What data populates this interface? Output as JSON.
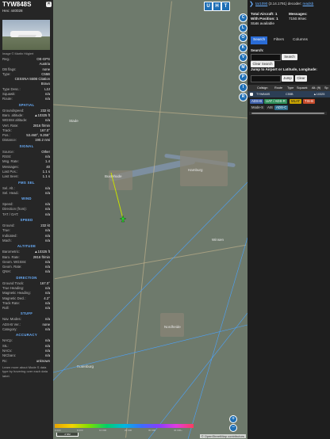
{
  "aircraft": {
    "callsign": "TYW848S",
    "hex_label": "Hex: ",
    "hex": "440028",
    "photo_credit": "Image © Martin Höglert"
  },
  "sidebar_rows_top": [
    {
      "k": "Reg.:",
      "v": "OE-GPS"
    },
    {
      "k": "",
      "v": "Austria"
    },
    {
      "k": "DB flags:",
      "v": "none"
    },
    {
      "k": "Type:",
      "v": "C55B"
    },
    {
      "k": "",
      "v": "CESSNA 550B Citation"
    },
    {
      "k": "",
      "v": "Bravo"
    },
    {
      "k": "Type Desc.:",
      "v": "L2J"
    },
    {
      "k": "Squawk:",
      "v": "n/a"
    },
    {
      "k": "Route:",
      "v": "n/a"
    }
  ],
  "sections": [
    {
      "title": "SPATIAL",
      "rows": [
        {
          "k": "Groundspeed:",
          "v": "232 kt"
        },
        {
          "k": "Baro. altitude:",
          "v": "▲10325 ft"
        },
        {
          "k": "WGS84 altitude:",
          "v": "n/a"
        },
        {
          "k": "Vert. Rate:",
          "v": "2816 ft/min"
        },
        {
          "k": "Track:",
          "v": "167.0°"
        },
        {
          "k": "Pos.:",
          "v": "53.460°, 9.255°"
        },
        {
          "k": "Distance:",
          "v": "190.2 nmi"
        }
      ]
    },
    {
      "title": "SIGNAL",
      "rows": [
        {
          "k": "Source:",
          "v": "Other"
        },
        {
          "k": "RSSI:",
          "v": "n/a"
        },
        {
          "k": "Msg. Rate:",
          "v": "1.4"
        },
        {
          "k": "Messages:",
          "v": "40"
        },
        {
          "k": "Last Pos.:",
          "v": "1.1 s"
        },
        {
          "k": "Last Seen:",
          "v": "1.1 s"
        }
      ]
    },
    {
      "title": "FMS SEL",
      "rows": [
        {
          "k": "Sel. Alt.:",
          "v": "n/a"
        },
        {
          "k": "Sel. Head.:",
          "v": "n/a"
        }
      ]
    },
    {
      "title": "WIND",
      "rows": [
        {
          "k": "Speed:",
          "v": "n/a"
        },
        {
          "k": "Direction (from):",
          "v": "n/a"
        },
        {
          "k": "TAT / OAT:",
          "v": "n/a"
        }
      ]
    },
    {
      "title": "SPEED",
      "rows": [
        {
          "k": "Ground:",
          "v": "232 kt"
        },
        {
          "k": "True:",
          "v": "n/a"
        },
        {
          "k": "Indicated:",
          "v": "n/a"
        },
        {
          "k": "Mach:",
          "v": "n/a"
        }
      ]
    },
    {
      "title": "ALTITUDE",
      "rows": [
        {
          "k": "Barometric:",
          "v": "▲10325 ft"
        },
        {
          "k": "Baro. Rate:",
          "v": "2816 ft/min"
        },
        {
          "k": "Geom. WGS84:",
          "v": "n/a"
        },
        {
          "k": "Geom. Rate:",
          "v": "n/a"
        },
        {
          "k": "QNH:",
          "v": "n/a"
        }
      ]
    },
    {
      "title": "DIRECTION",
      "rows": [
        {
          "k": "Ground Track:",
          "v": "167.0°"
        },
        {
          "k": "True Heading:",
          "v": "n/a"
        },
        {
          "k": "Magnetic Heading:",
          "v": "n/a"
        },
        {
          "k": "Magnetic Decl.:",
          "v": "4.2°"
        },
        {
          "k": "Track Rate:",
          "v": "n/a"
        },
        {
          "k": "Roll:",
          "v": "n/a"
        }
      ]
    },
    {
      "title": "STUFF",
      "rows": [
        {
          "k": "Nav. Modes:",
          "v": "n/a"
        },
        {
          "k": "ADS-B Ver.:",
          "v": "none"
        },
        {
          "k": "Category:",
          "v": "n/a"
        }
      ]
    },
    {
      "title": "ACCURACY",
      "rows": [
        {
          "k": "NACp:",
          "v": "n/a"
        },
        {
          "k": "SIL:",
          "v": "n/a"
        },
        {
          "k": "NACv:",
          "v": "n/a"
        },
        {
          "k": "NICbaro:",
          "v": "n/a"
        },
        {
          "k": "Rc:",
          "v": "unknown"
        }
      ]
    }
  ],
  "footer_text": "Learn more about Mode S data type by hovering over each data label.",
  "map": {
    "buttons": [
      "U",
      "H",
      "T"
    ],
    "labels": [
      "Buxtehude",
      "Hamburg",
      "Stade",
      "Winsen",
      "Nordheide",
      "Rotenburg"
    ],
    "altitude_ticks": [
      "6 000",
      "8 000",
      "10 000",
      "20 000",
      "30 000",
      "40 000+"
    ],
    "scale": "2 NM",
    "attribution": "© OpenStreetMap contributors",
    "zoom_in": "+",
    "zoom_out": "−"
  },
  "toolbar": [
    "C",
    "L",
    "O",
    "K",
    "V",
    "M",
    "P",
    "I",
    "R"
  ],
  "panel": {
    "arrow": "❯",
    "version_prefix": "tar1090",
    "version_rest": " (3.14.1791) decoder: ",
    "decoder": "readsb",
    "total_label": "Total Aircraft: ",
    "total": "1",
    "messages_label": "Messages:",
    "messages": "7150.9/sec",
    "with_pos_label": "With Position: ",
    "with_pos": "1",
    "stats": "Stats available",
    "tabs": [
      "Search",
      "Filters",
      "Columns"
    ],
    "search_label": "Search:",
    "search_btn": "Search",
    "clear_btn": "Clear Search",
    "jump_label": "Jump to Airport or Latitude, Longitude:",
    "jump_btn": "Jump",
    "jump_clear": "Clear",
    "columns": [
      "Callsign",
      "Route",
      "Type",
      "Squawk",
      "Alt. (ft)",
      "Sp"
    ],
    "row": {
      "callsign": "TYW848S",
      "type": "C55B",
      "alt": "▲10325"
    },
    "tags": [
      "ADS-B",
      "UAT / ADS-R",
      "MLAT",
      "TIS-B",
      "Mode-S",
      "AIS",
      "ADS-C"
    ]
  }
}
